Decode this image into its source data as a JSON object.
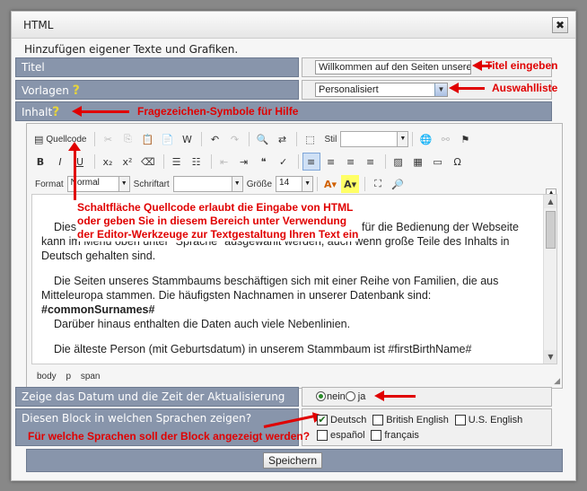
{
  "dialog": {
    "title": "HTML",
    "close_symbol": "✖",
    "intro": "Hinzufügen eigener Texte und Grafiken."
  },
  "fields": {
    "titel_label": "Titel",
    "titel_value": "Willkommen auf den Seiten unseres",
    "vorlagen_label": "Vorlagen",
    "vorlagen_value": "Personalisiert",
    "inhalt_label": "Inhalt",
    "help_mark": "?"
  },
  "annotations": {
    "titel": "Titel eingeben",
    "vorlagen": "Auswahlliste",
    "help": "Fragezeichen-Symbole für Hilfe",
    "source_line1": "Schaltfläche Quellcode erlaubt die Eingabe von HTML",
    "source_line2": "oder geben Sie in diesem Bereich unter Verwendung",
    "source_line3": "der Editor-Werkzeuge zur Textgestaltung Ihren Text ein",
    "languages": "Für welche Sprachen soll der Block angezeigt werden?"
  },
  "toolbar": {
    "source_button": "Quellcode",
    "style_label": "Stil",
    "format_label": "Format",
    "format_value": "Normal",
    "font_label": "Schriftart",
    "font_value": "",
    "size_label": "Größe",
    "size_value": "14"
  },
  "editor": {
    "para1_a": "Dies",
    "para1_b": "für die Bedienung der Webseite",
    "para1_c": "kann im Menü oben unter \"Sprache\" ausgewählt werden, auch wenn große Teile des Inhalts in",
    "para1_d": "Deutsch gehalten sind.",
    "para2_a": "Die Seiten unseres Stammbaums beschäftigen sich mit einer Reihe von Familien, die aus",
    "para2_b": "Mitteleuropa stammen. Die häufigsten Nachnamen in unserer Datenbank sind:",
    "para2_c": "#commonSurnames#",
    "para2_d": "Darüber hinaus enthalten die Daten auch viele Nebenlinien.",
    "para3_a": "Die älteste Person (mit Geburtsdatum) in unserem Stammbaum ist #firstBirthName#",
    "path": [
      "body",
      "p",
      "span"
    ]
  },
  "datetime": {
    "label": "Zeige das Datum und die Zeit der Aktualisierung",
    "option_no": "nein",
    "option_yes": "ja",
    "selected": "nein"
  },
  "languages": {
    "label": "Diesen Block in welchen Sprachen zeigen?",
    "options": [
      {
        "label": "Deutsch",
        "checked": true
      },
      {
        "label": "British English",
        "checked": false
      },
      {
        "label": "U.S. English",
        "checked": false
      },
      {
        "label": "español",
        "checked": false
      },
      {
        "label": "français",
        "checked": false
      }
    ]
  },
  "actions": {
    "save_label": "Speichern"
  },
  "colors": {
    "label_bg": "#8895ab",
    "annotation_red": "#e00000"
  }
}
